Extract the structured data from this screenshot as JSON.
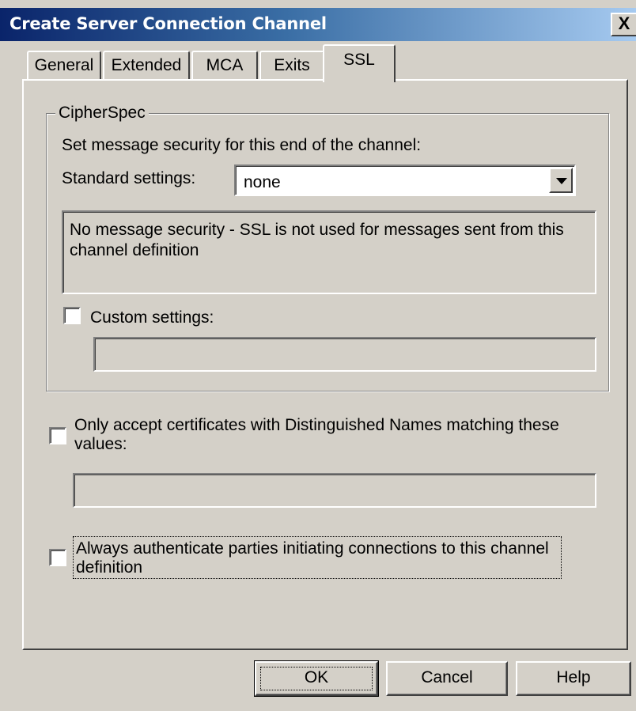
{
  "window": {
    "title": "Create Server Connection Channel",
    "close_glyph": "X"
  },
  "tabs": [
    {
      "label": "General"
    },
    {
      "label": "Extended"
    },
    {
      "label": "MCA"
    },
    {
      "label": "Exits"
    },
    {
      "label": "SSL",
      "active": true
    }
  ],
  "cipherspec": {
    "group_label": "CipherSpec",
    "intro": "Set message security for this end of the channel:",
    "standard_label": "Standard settings:",
    "standard_value": "none",
    "description": "No message security - SSL is not used for messages sent from this channel definition",
    "custom_label": "Custom settings:",
    "custom_checked": false,
    "custom_value": ""
  },
  "dn_filter": {
    "label": "Only accept certificates with Distinguished Names matching these values:",
    "checked": false,
    "value": ""
  },
  "auth": {
    "label": "Always authenticate parties initiating connections to this channel definition",
    "checked": false
  },
  "buttons": {
    "ok": "OK",
    "cancel": "Cancel",
    "help": "Help"
  }
}
